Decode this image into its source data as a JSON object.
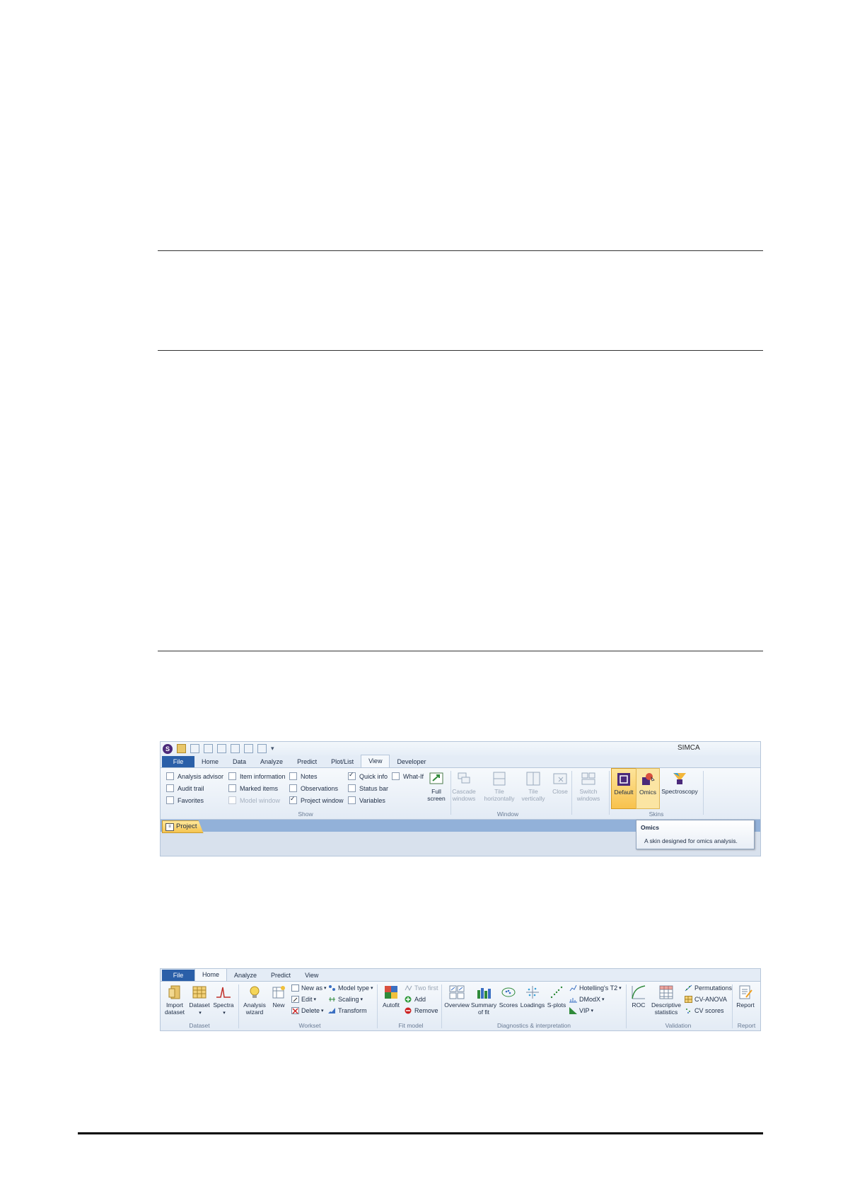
{
  "view_screenshot": {
    "app_title": "SIMCA",
    "tabs": [
      "File",
      "Home",
      "Data",
      "Analyze",
      "Predict",
      "Plot/List",
      "View",
      "Developer"
    ],
    "active_tab": "View",
    "show_group": {
      "label": "Show",
      "checkboxes": [
        {
          "label": "Analysis advisor",
          "checked": false,
          "enabled": true
        },
        {
          "label": "Audit trail",
          "checked": false,
          "enabled": true
        },
        {
          "label": "Favorites",
          "checked": false,
          "enabled": true
        },
        {
          "label": "Item information",
          "checked": false,
          "enabled": true
        },
        {
          "label": "Marked items",
          "checked": false,
          "enabled": true
        },
        {
          "label": "Model window",
          "checked": false,
          "enabled": false
        },
        {
          "label": "Notes",
          "checked": false,
          "enabled": true
        },
        {
          "label": "Observations",
          "checked": false,
          "enabled": true
        },
        {
          "label": "Project window",
          "checked": true,
          "enabled": true
        },
        {
          "label": "Quick info",
          "checked": true,
          "enabled": true
        },
        {
          "label": "Status bar",
          "checked": false,
          "enabled": true
        },
        {
          "label": "Variables",
          "checked": false,
          "enabled": true
        },
        {
          "label": "What-If",
          "checked": false,
          "enabled": true
        }
      ],
      "full_screen_label": "Full\nscreen"
    },
    "window_group": {
      "label": "Window",
      "buttons": [
        "Cascade\nwindows",
        "Tile\nhorizontally",
        "Tile\nvertically",
        "Close",
        "Switch\nwindows"
      ]
    },
    "skins_group": {
      "label": "Skins",
      "buttons": [
        "Default",
        "Omics",
        "Spectroscopy"
      ],
      "selected": "Default"
    },
    "project_tab": "Project",
    "tooltip": {
      "title": "Omics",
      "text": "A skin designed for omics analysis."
    },
    "colors": {
      "ribbon_bg": "#e3ebf5",
      "file_tab": "#2a5fa8",
      "selected_skin": "#f8c24d"
    }
  },
  "home_screenshot": {
    "tabs": [
      "File",
      "Home",
      "Analyze",
      "Predict",
      "View"
    ],
    "active_tab": "Home",
    "groups": {
      "dataset": {
        "label": "Dataset",
        "buttons": [
          "Import\ndataset",
          "Dataset",
          "Spectra"
        ]
      },
      "workset": {
        "label": "Workset",
        "big_buttons": [
          "Analysis\nwizard",
          "New"
        ],
        "small_buttons": [
          "New as",
          "Edit",
          "Delete",
          "Model type",
          "Scaling",
          "Transform"
        ]
      },
      "fit_model": {
        "label": "Fit model",
        "big_button": "Autofit",
        "small_buttons": [
          "Two first",
          "Add",
          "Remove"
        ]
      },
      "diagnostics": {
        "label": "Diagnostics & interpretation",
        "big_buttons": [
          "Overview",
          "Summary\nof fit",
          "Scores",
          "Loadings",
          "S-plots"
        ],
        "small_buttons": [
          "Hotelling's T2",
          "DModX",
          "VIP"
        ]
      },
      "validation": {
        "label": "Validation",
        "big_buttons": [
          "ROC",
          "Descriptive\nstatistics"
        ],
        "small_buttons": [
          "Permutations",
          "CV-ANOVA",
          "CV scores"
        ]
      },
      "report": {
        "label": "Report",
        "big_button": "Report"
      }
    }
  }
}
